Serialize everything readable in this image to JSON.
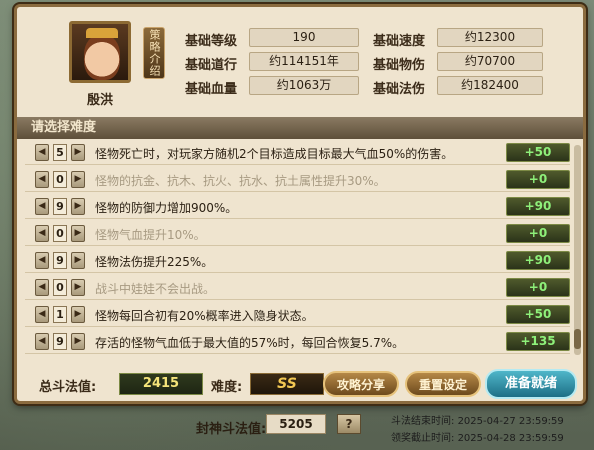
{
  "hero": {
    "name": "殷洪",
    "strategy_label": "策略介绍"
  },
  "stats": {
    "level_label": "基础等级",
    "level_value": "190",
    "speed_label": "基础速度",
    "speed_value": "约12300",
    "dao_label": "基础道行",
    "dao_value": "约114151年",
    "phys_label": "基础物伤",
    "phys_value": "约70700",
    "hp_label": "基础血量",
    "hp_value": "约1063万",
    "magic_label": "基础法伤",
    "magic_value": "约182400"
  },
  "section_title": "请选择难度",
  "arrows": {
    "left": "◀",
    "right": "▶"
  },
  "rows": [
    {
      "level": "5",
      "text": "怪物死亡时，对玩家方随机2个目标造成目标最大气血50%的伤害。",
      "score": "+50",
      "active": true
    },
    {
      "level": "0",
      "text": "怪物的抗金、抗木、抗火、抗水、抗土属性提升30%。",
      "score": "+0",
      "active": false
    },
    {
      "level": "9",
      "text": "怪物的防御力增加900%。",
      "score": "+90",
      "active": true
    },
    {
      "level": "0",
      "text": "怪物气血提升10%。",
      "score": "+0",
      "active": false
    },
    {
      "level": "9",
      "text": "怪物法伤提升225%。",
      "score": "+90",
      "active": true
    },
    {
      "level": "0",
      "text": "战斗中娃娃不会出战。",
      "score": "+0",
      "active": false
    },
    {
      "level": "1",
      "text": "怪物每回合初有20%概率进入隐身状态。",
      "score": "+50",
      "active": true
    },
    {
      "level": "9",
      "text": "存活的怪物气血低于最大值的57%时，每回合恢复5.7%。",
      "score": "+135",
      "active": true
    }
  ],
  "footer": {
    "total_label": "总斗法值:",
    "total_value": "2415",
    "difficulty_label": "难度:",
    "difficulty_value": "SS",
    "share_button": "攻略分享",
    "reset_button": "重置设定",
    "ready_button": "准备就绪",
    "seal_label": "封神斗法值:",
    "seal_value": "5205",
    "help_button": "?",
    "end_time_label": "斗法结束时间:",
    "end_time_value": "2025-04-27 23:59:59",
    "claim_time_label": "领奖截止时间:",
    "claim_time_value": "2025-04-28 23:59:59"
  }
}
